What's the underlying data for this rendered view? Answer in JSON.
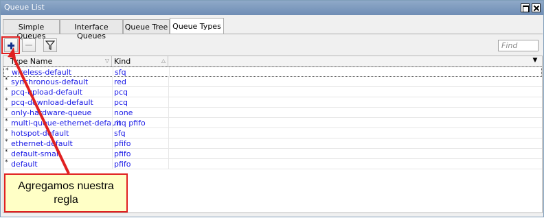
{
  "window": {
    "title": "Queue List"
  },
  "tabs": [
    {
      "label": "Simple Queues",
      "active": false
    },
    {
      "label": "Interface Queues",
      "active": false
    },
    {
      "label": "Queue Tree",
      "active": false
    },
    {
      "label": "Queue Types",
      "active": true
    }
  ],
  "toolbar": {
    "find_placeholder": "Find"
  },
  "table": {
    "columns": [
      "Type Name",
      "Kind"
    ],
    "rows": [
      {
        "flag": "*",
        "name": "wireless-default",
        "kind": "sfq"
      },
      {
        "flag": "*",
        "name": "synchronous-default",
        "kind": "red"
      },
      {
        "flag": "*",
        "name": "pcq-upload-default",
        "kind": "pcq"
      },
      {
        "flag": "*",
        "name": "pcq-download-default",
        "kind": "pcq"
      },
      {
        "flag": "*",
        "name": "only-hardware-queue",
        "kind": "none"
      },
      {
        "flag": "*",
        "name": "multi-queue-ethernet-default",
        "kind": "mq pfifo"
      },
      {
        "flag": "*",
        "name": "hotspot-default",
        "kind": "sfq"
      },
      {
        "flag": "*",
        "name": "ethernet-default",
        "kind": "pfifo"
      },
      {
        "flag": "*",
        "name": "default-small",
        "kind": "pfifo"
      },
      {
        "flag": "*",
        "name": "default",
        "kind": "pfifo"
      }
    ]
  },
  "callout": {
    "line1": "Agregamos nuestra",
    "line2": "regla"
  },
  "colors": {
    "accent": "#e02020",
    "link": "#1a1ae6",
    "callout_bg": "#ffffc6"
  }
}
